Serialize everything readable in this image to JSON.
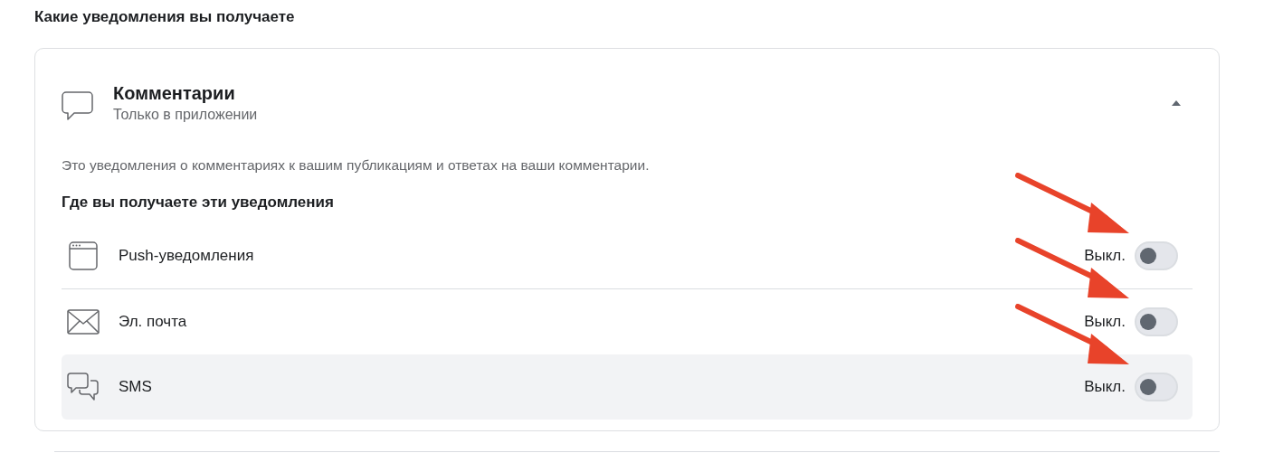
{
  "heading": "Какие уведомления вы получаете",
  "toggle_arrows": true,
  "card": {
    "title": "Комментарии",
    "subtitle": "Только в приложении",
    "expanded": true,
    "description": "Это уведомления о комментариях к вашим публикациям и ответах на ваши комментарии.",
    "channels_heading": "Где вы получаете эти уведомления",
    "channels": [
      {
        "kind": "browser",
        "label": "Push-уведомления",
        "state_text": "Выкл.",
        "on": false,
        "selected": false
      },
      {
        "kind": "mail",
        "label": "Эл. почта",
        "state_text": "Выкл.",
        "on": false,
        "selected": false
      },
      {
        "kind": "chat",
        "label": "SMS",
        "state_text": "Выкл.",
        "on": false,
        "selected": true
      }
    ]
  }
}
